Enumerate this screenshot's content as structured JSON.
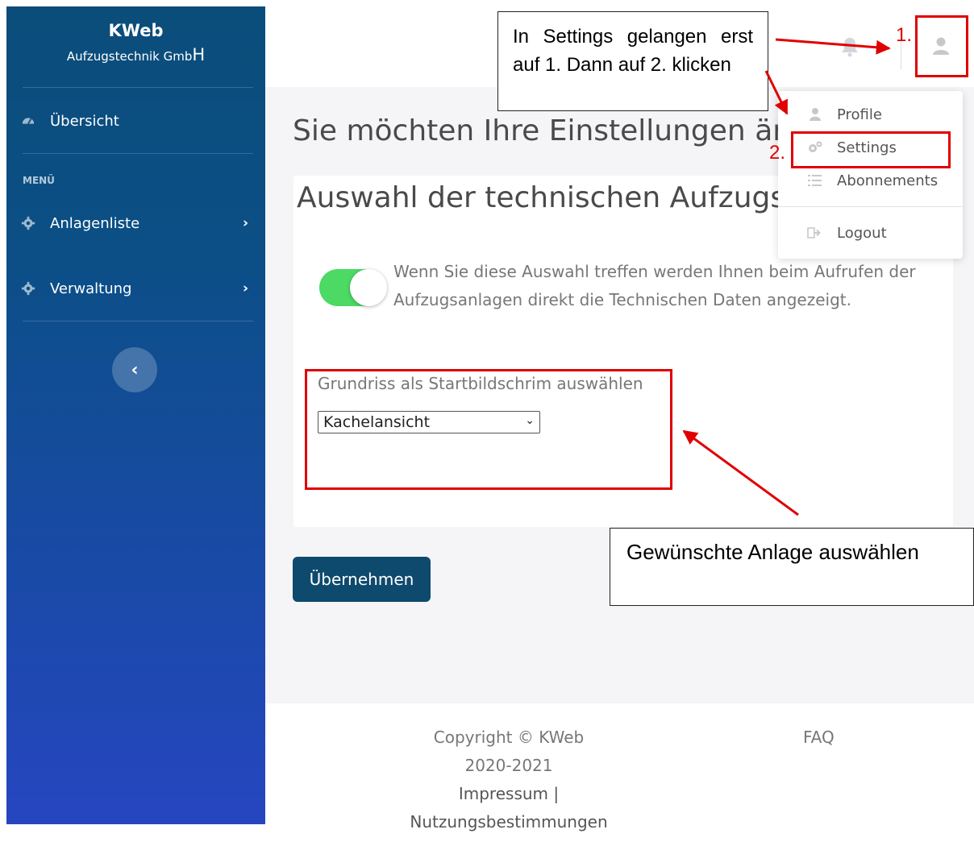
{
  "sidebar": {
    "brand_title": "KWeb",
    "brand_subtitle": "Aufzugstechnik Gmb",
    "brand_subtitle_last": "H",
    "overview_label": "Übersicht",
    "menu_label": "MENÜ",
    "items": [
      {
        "label": "Anlagenliste",
        "icon": "gear-icon"
      },
      {
        "label": "Verwaltung",
        "icon": "gear-icon"
      }
    ],
    "collapse_icon": "chevron-left-icon"
  },
  "topbar": {
    "bell_icon": "bell-icon",
    "user_icon": "user-icon"
  },
  "user_menu": {
    "items": [
      {
        "label": "Profile",
        "icon": "user-icon"
      },
      {
        "label": "Settings",
        "icon": "gears-icon"
      },
      {
        "label": "Abonnements",
        "icon": "list-icon"
      },
      {
        "label": "Logout",
        "icon": "sign-out-icon"
      }
    ]
  },
  "main": {
    "heading": "Sie möchten Ihre Einstellungen än",
    "card_title": "Auswahl der technischen Aufzugs",
    "toggle_on": true,
    "toggle_text": "Wenn Sie diese Auswahl treffen werden Ihnen beim Aufrufen der Aufzugsanlagen direkt die Technischen Daten angezeigt.",
    "select_label": "Grundriss als Startbildschrim auswählen",
    "select_value": "Kachelansicht",
    "apply_button": "Übernehmen"
  },
  "footer": {
    "copyright_line1": "Copyright © KWeb",
    "copyright_line2": "2020-2021",
    "impressum": "Impressum |",
    "terms": "Nutzungsbestimmungen",
    "faq": "FAQ"
  },
  "annotations": {
    "callout1": "In Settings gelangen erst auf 1. Dann auf 2. klicken",
    "callout2": "Gewünschte Anlage auswählen",
    "marker1": "1.",
    "marker2": "2.",
    "color": "#e00000"
  }
}
